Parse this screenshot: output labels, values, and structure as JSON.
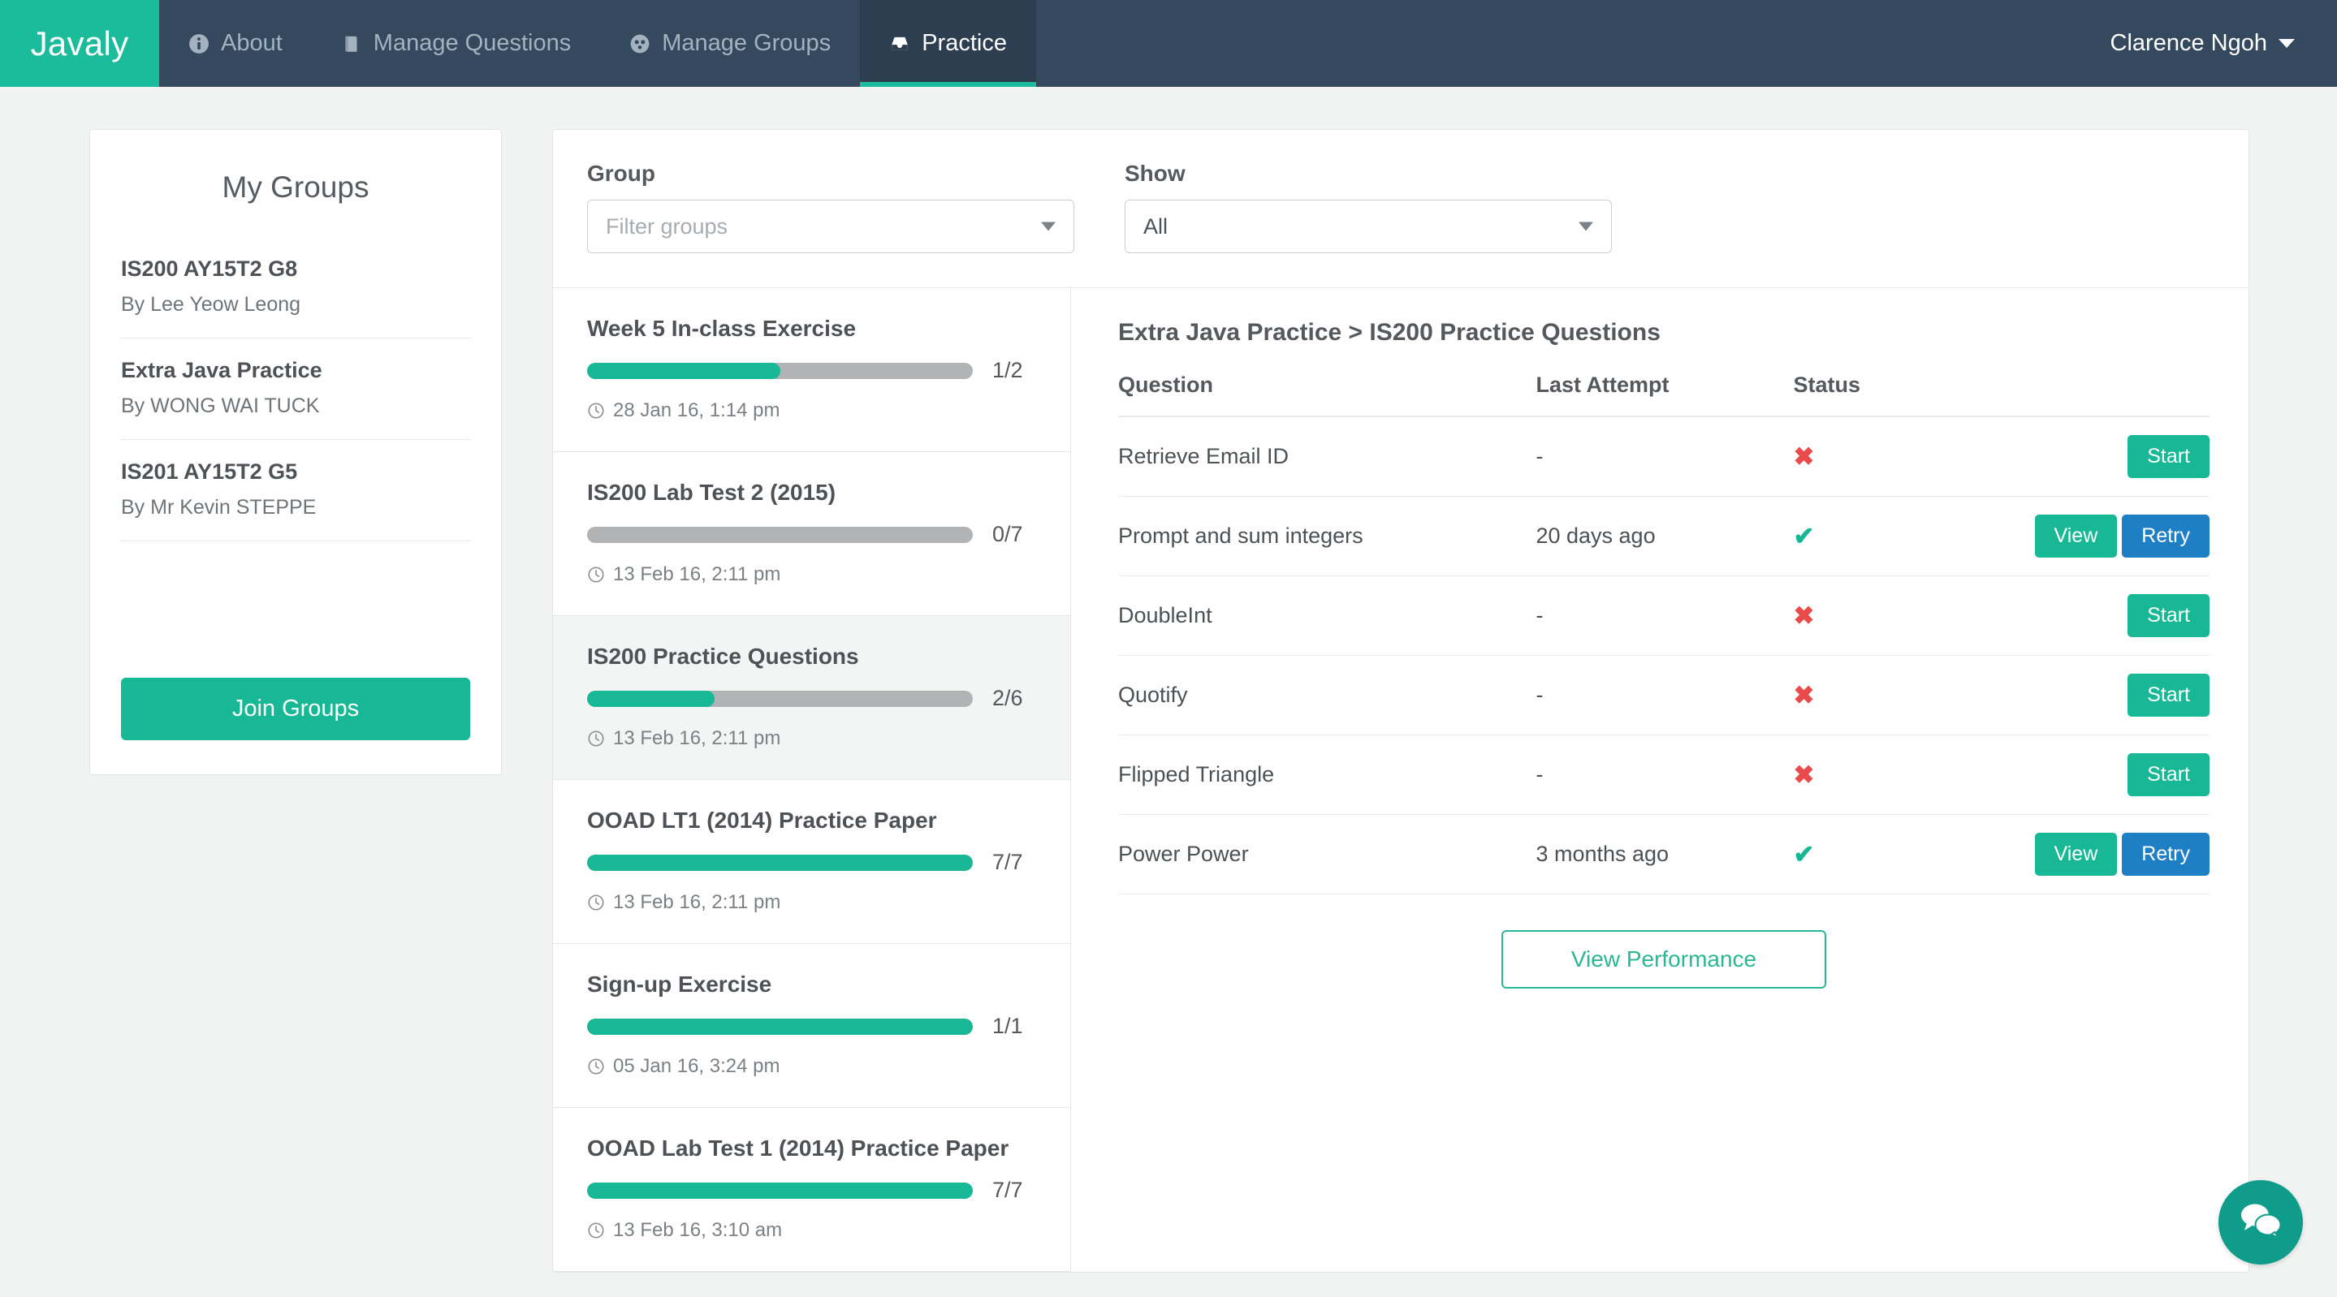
{
  "navbar": {
    "brand": "Javaly",
    "items": [
      {
        "label": "About",
        "icon": "info-circle-icon",
        "active": false
      },
      {
        "label": "Manage Questions",
        "icon": "book-icon",
        "active": false
      },
      {
        "label": "Manage Groups",
        "icon": "group-icon",
        "active": false
      },
      {
        "label": "Practice",
        "icon": "inbox-icon",
        "active": true
      }
    ],
    "user": "Clarence Ngoh",
    "user_caret": "chevron-down-icon"
  },
  "sidebar": {
    "title": "My Groups",
    "groups": [
      {
        "name": "IS200 AY15T2 G8",
        "by": "By Lee Yeow Leong"
      },
      {
        "name": "Extra Java Practice",
        "by": "By WONG WAI TUCK"
      },
      {
        "name": "IS201 AY15T2 G5",
        "by": "By Mr Kevin STEPPE"
      }
    ],
    "join_label": "Join Groups"
  },
  "filters": {
    "group_label": "Group",
    "group_placeholder": "Filter groups",
    "show_label": "Show",
    "show_value": "All"
  },
  "exercises": [
    {
      "title": "Week 5 In-class Exercise",
      "done": 1,
      "total": 2,
      "progress_label": "1/2",
      "percent": 50,
      "date": "28 Jan 16, 1:14 pm",
      "selected": false
    },
    {
      "title": "IS200 Lab Test 2 (2015)",
      "done": 0,
      "total": 7,
      "progress_label": "0/7",
      "percent": 0,
      "date": "13 Feb 16, 2:11 pm",
      "selected": false
    },
    {
      "title": "IS200 Practice Questions",
      "done": 2,
      "total": 6,
      "progress_label": "2/6",
      "percent": 33,
      "date": "13 Feb 16, 2:11 pm",
      "selected": true
    },
    {
      "title": "OOAD LT1 (2014) Practice Paper",
      "done": 7,
      "total": 7,
      "progress_label": "7/7",
      "percent": 100,
      "date": "13 Feb 16, 2:11 pm",
      "selected": false
    },
    {
      "title": "Sign-up Exercise",
      "done": 1,
      "total": 1,
      "progress_label": "1/1",
      "percent": 100,
      "date": "05 Jan 16, 3:24 pm",
      "selected": false
    },
    {
      "title": "OOAD Lab Test 1 (2014) Practice Paper",
      "done": 7,
      "total": 7,
      "progress_label": "7/7",
      "percent": 100,
      "date": "13 Feb 16, 3:10 am",
      "selected": false
    }
  ],
  "detail": {
    "breadcrumb": "Extra Java Practice > IS200 Practice Questions",
    "columns": [
      "Question",
      "Last Attempt",
      "Status"
    ],
    "rows": [
      {
        "question": "Retrieve Email ID",
        "last_attempt": "-",
        "status": "fail",
        "status_glyph": "✖",
        "actions": [
          {
            "label": "Start",
            "kind": "start"
          }
        ]
      },
      {
        "question": "Prompt and sum integers",
        "last_attempt": "20 days ago",
        "status": "pass",
        "status_glyph": "✔",
        "actions": [
          {
            "label": "View",
            "kind": "view"
          },
          {
            "label": "Retry",
            "kind": "retry"
          }
        ]
      },
      {
        "question": "DoubleInt",
        "last_attempt": "-",
        "status": "fail",
        "status_glyph": "✖",
        "actions": [
          {
            "label": "Start",
            "kind": "start"
          }
        ]
      },
      {
        "question": "Quotify",
        "last_attempt": "-",
        "status": "fail",
        "status_glyph": "✖",
        "actions": [
          {
            "label": "Start",
            "kind": "start"
          }
        ]
      },
      {
        "question": "Flipped Triangle",
        "last_attempt": "-",
        "status": "fail",
        "status_glyph": "✖",
        "actions": [
          {
            "label": "Start",
            "kind": "start"
          }
        ]
      },
      {
        "question": "Power Power",
        "last_attempt": "3 months ago",
        "status": "pass",
        "status_glyph": "✔",
        "actions": [
          {
            "label": "View",
            "kind": "view"
          },
          {
            "label": "Retry",
            "kind": "retry"
          }
        ]
      }
    ],
    "performance_label": "View Performance"
  },
  "chat": {
    "icon": "chat-bubbles-icon"
  },
  "colors": {
    "brand_teal": "#1abc9c",
    "navbar_dark": "#34495e",
    "navbar_active": "#2c3e50",
    "button_green": "#18b795",
    "button_blue": "#1f7fc4",
    "status_fail_red": "#e94b4b",
    "status_pass_green": "#16b795",
    "page_bg": "#f1f2f2",
    "chat_teal": "#0f9c8a"
  }
}
